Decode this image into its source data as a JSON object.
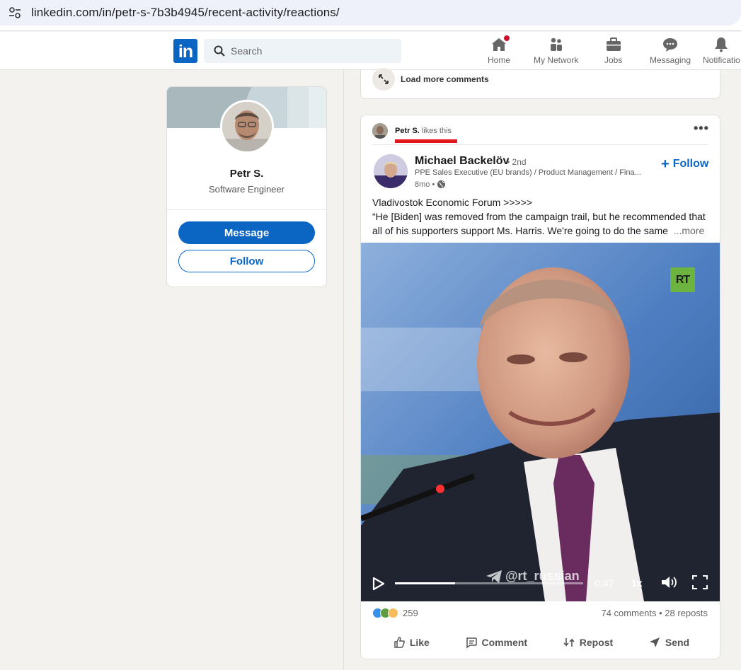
{
  "browser": {
    "url": "linkedin.com/in/petr-s-7b3b4945/recent-activity/reactions/"
  },
  "nav": {
    "logo": "in",
    "search_placeholder": "Search",
    "items": [
      {
        "label": "Home",
        "icon": "home-icon"
      },
      {
        "label": "My Network",
        "icon": "network-icon"
      },
      {
        "label": "Jobs",
        "icon": "briefcase-icon"
      },
      {
        "label": "Messaging",
        "icon": "messaging-icon"
      },
      {
        "label": "Notificatio",
        "icon": "bell-icon"
      }
    ]
  },
  "profile": {
    "name": "Petr S.",
    "title": "Software Engineer",
    "message_label": "Message",
    "follow_label": "Follow"
  },
  "feed": {
    "load_more": "Load more comments",
    "post": {
      "liker_name": "Petr S.",
      "liker_action": "likes this",
      "author_name": "Michael Backelöv",
      "author_degree": "• 2nd",
      "author_headline": "PPE Sales Executive (EU brands) / Product Management / Fina...",
      "author_time": "8mo •",
      "follow_label": "Follow",
      "text_lines": [
        "Vladivostok Economic Forum >>>>>",
        "“He [Biden] was removed from the campaign trail, but he recommended that",
        "all of his supporters support Ms. Harris. We're going to do the same"
      ],
      "more_label": "...more",
      "video": {
        "channel_logo": "RT",
        "watermark": "@rt_russian",
        "time": "0:47",
        "speed": "1x",
        "progress": 0.32
      },
      "reaction_count": "259",
      "comments_reposts": "74 comments • 28 reposts",
      "actions": [
        "Like",
        "Comment",
        "Repost",
        "Send"
      ]
    }
  },
  "colors": {
    "brand": "#0a66c2",
    "highlight": "#e3161b",
    "rt_green": "#6cb33f"
  }
}
